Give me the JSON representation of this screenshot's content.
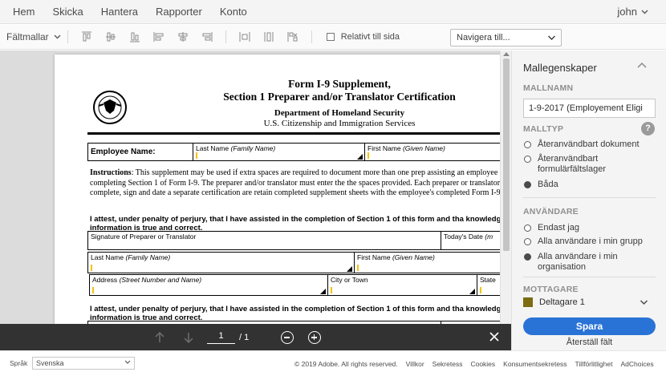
{
  "topnav": {
    "items": [
      "Hem",
      "Skicka",
      "Hantera",
      "Rapporter",
      "Konto"
    ],
    "user": "john"
  },
  "toolbar": {
    "templates_label": "Fältmallar",
    "relative_label": "Relativt till sida",
    "navigate_placeholder": "Navigera till..."
  },
  "document": {
    "title_line1": "Form I-9 Supplement,",
    "title_line2": "Section 1 Preparer and/or Translator Certification",
    "dept": "Department of Homeland Security",
    "agency": "U.S. Citizenship and Immigration Services",
    "employee_name_label": "Employee Name:",
    "last_name_label": "Last Name",
    "last_name_hint": "(Family Name)",
    "first_name_label": "First Name",
    "first_name_hint": "(Given Name)",
    "instructions_head": "Instructions",
    "instructions_body": ": This supplement may be used if extra spaces are required to document more than one prep assisting an employee in completing Section 1 of Form I-9. The preparer and/or translator must enter the the spaces provided. Each preparer or translator must complete, sign and date a separate certification are retain completed supplement sheets with the employee's completed Form I-9.",
    "attest": "I attest, under penalty of perjury, that I have assisted in the completion of Section 1 of this form and tha knowledge the information is true and correct.",
    "signature_label": "Signature of Preparer or Translator",
    "todays_date_label": "Today's Date",
    "todays_date_hint": "(m",
    "address_label": "Address",
    "address_hint": "(Street Number and Name)",
    "city_label": "City or Town",
    "state_label": "State"
  },
  "doc_toolbar": {
    "page_current": "1",
    "page_total": "/ 1"
  },
  "panel": {
    "title": "Mallegenskaper",
    "name_label": "MALLNAMN",
    "name_value": "1-9-2017 (Employement Eligi",
    "type_label": "MALLTYP",
    "type_options": [
      {
        "label": "Återanvändbart dokument",
        "selected": false
      },
      {
        "label": "Återanvändbart formulärfältslager",
        "selected": false
      },
      {
        "label": "Båda",
        "selected": true
      }
    ],
    "users_label": "ANVÄNDARE",
    "user_options": [
      {
        "label": "Endast jag",
        "selected": false
      },
      {
        "label": "Alla användare i min grupp",
        "selected": false
      },
      {
        "label": "Alla användare i min organisation",
        "selected": true
      }
    ],
    "recipient_label": "MOTTAGARE",
    "recipient_value": "Deltagare 1",
    "recipient_color": "#7d6b12",
    "save_label": "Spara",
    "reset_label": "Återställ fält"
  },
  "footer": {
    "lang_label": "Språk",
    "lang_value": "Svenska",
    "links": [
      "© 2019 Adobe. All rights reserved.",
      "Villkor",
      "Sekretess",
      "Cookies",
      "Konsumentsekretess",
      "Tillförlitlighet",
      "AdChoices"
    ]
  },
  "colors": {
    "accent": "#2a73d6",
    "dark_toolbar": "#323232"
  }
}
